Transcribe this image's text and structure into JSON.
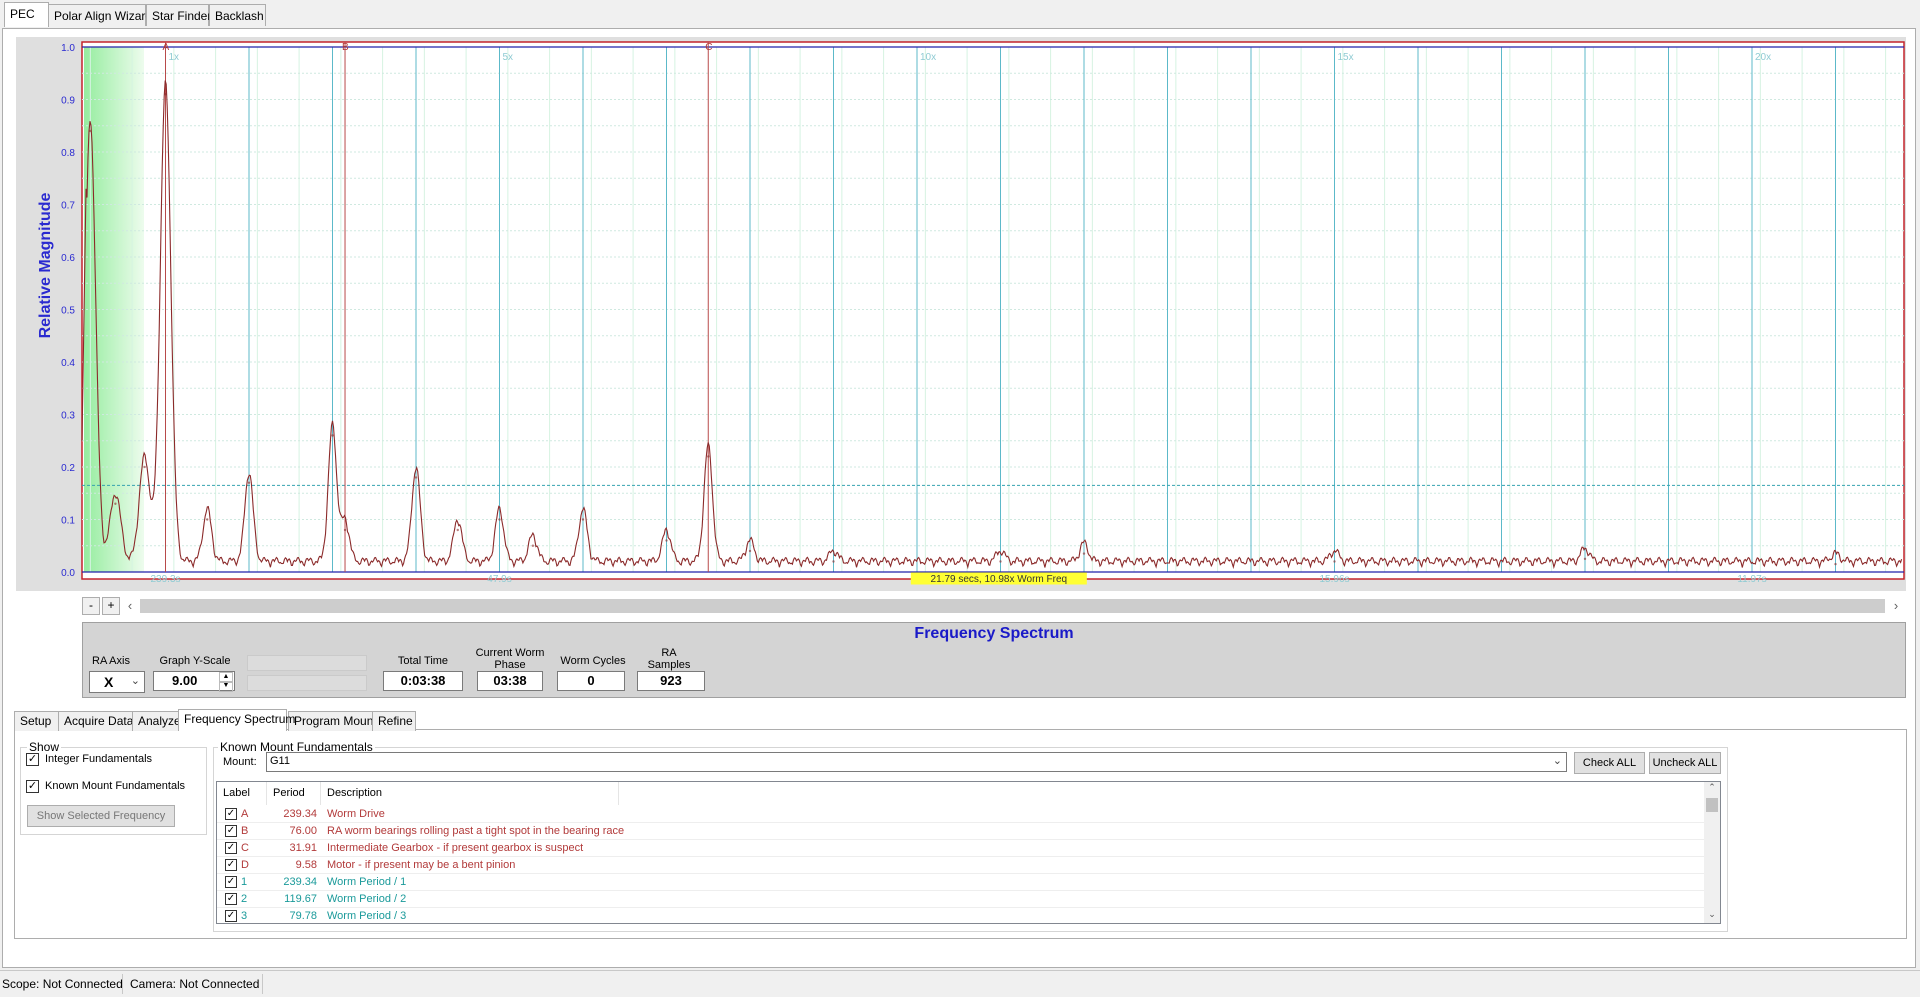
{
  "top_tabs": [
    "PEC",
    "Polar Align Wizard",
    "Star Finder",
    "Backlash"
  ],
  "chart_data": {
    "type": "line",
    "title": "",
    "ylabel": "Relative Magnitude",
    "xlabel": "",
    "ylim": [
      0,
      1.0
    ],
    "y_ticks": [
      "0.0",
      "0.1",
      "0.2",
      "0.3",
      "0.4",
      "0.5",
      "0.6",
      "0.7",
      "0.8",
      "0.9",
      "1.0"
    ],
    "harmonic_labels": [
      "1x",
      "5x",
      "10x",
      "15x",
      "20x"
    ],
    "bottom_period_labels": [
      "239.3s",
      "47.9s",
      "21.79 secs, 10.98x Worm Freq",
      "15.96s",
      "11.97s"
    ],
    "fundamental_markers": [
      "A",
      "B",
      "C"
    ],
    "threshold": 0.165,
    "series": [
      {
        "color": "#8b2a2a",
        "peaks": [
          {
            "x": 0.1,
            "y": 0.84
          },
          {
            "x": 0.4,
            "y": 0.13
          },
          {
            "x": 0.75,
            "y": 0.2
          },
          {
            "x": 1.0,
            "y": 0.91
          },
          {
            "x": 1.5,
            "y": 0.1
          },
          {
            "x": 2.0,
            "y": 0.17
          },
          {
            "x": 3.0,
            "y": 0.26
          },
          {
            "x": 3.15,
            "y": 0.08
          },
          {
            "x": 4.0,
            "y": 0.18
          },
          {
            "x": 4.5,
            "y": 0.08
          },
          {
            "x": 5.0,
            "y": 0.1
          },
          {
            "x": 5.4,
            "y": 0.05
          },
          {
            "x": 6.0,
            "y": 0.1
          },
          {
            "x": 7.0,
            "y": 0.06
          },
          {
            "x": 7.5,
            "y": 0.22
          },
          {
            "x": 8.0,
            "y": 0.04
          },
          {
            "x": 9.0,
            "y": 0.02
          },
          {
            "x": 11.0,
            "y": 0.02
          },
          {
            "x": 12.0,
            "y": 0.035
          },
          {
            "x": 15.0,
            "y": 0.02
          },
          {
            "x": 18.0,
            "y": 0.025
          },
          {
            "x": 21.0,
            "y": 0.015
          }
        ]
      }
    ]
  },
  "info": {
    "title": "Frequency Spectrum",
    "ra_axis_label": "RA Axis",
    "ra_axis_value": "X",
    "y_scale_label": "Graph Y-Scale",
    "y_scale_value": "9.00",
    "total_time_label": "Total Time",
    "total_time_value": "0:03:38",
    "worm_phase_label_1": "Current Worm",
    "worm_phase_label_2": "Phase",
    "worm_phase_value": "03:38",
    "worm_cycles_label": "Worm Cycles",
    "worm_cycles_value": "0",
    "ra_samples_label_1": "RA",
    "ra_samples_label_2": "Samples",
    "ra_samples_value": "923"
  },
  "scroll": {
    "minus": "-",
    "plus": "+"
  },
  "bottom_tabs": [
    "Setup",
    "Acquire Data",
    "Analyze",
    "Frequency Spectrum",
    "Program Mount",
    "Refine"
  ],
  "show": {
    "title": "Show",
    "integer_fundamentals": "Integer Fundamentals",
    "known_mount_fundamentals": "Known Mount Fundamentals",
    "show_selected_button": "Show Selected Frequency"
  },
  "kmf": {
    "title": "Known Mount Fundamentals",
    "mount_label": "Mount:",
    "mount_value": "G11",
    "check_all": "Check ALL",
    "uncheck_all": "Uncheck ALL",
    "columns": [
      "Label",
      "Period",
      "Description"
    ],
    "rows": [
      {
        "label": "A",
        "period": "239.34",
        "desc": "Worm Drive",
        "color": "#b23a3a"
      },
      {
        "label": "B",
        "period": "76.00",
        "desc": "RA worm bearings rolling past a tight spot in the bearing race",
        "color": "#b23a3a"
      },
      {
        "label": "C",
        "period": "31.91",
        "desc": "Intermediate Gearbox - if present gearbox is suspect",
        "color": "#b23a3a"
      },
      {
        "label": "D",
        "period": "9.58",
        "desc": "Motor - if present may be a bent pinion",
        "color": "#b23a3a"
      },
      {
        "label": "1",
        "period": "239.34",
        "desc": "Worm Period / 1",
        "color": "#1a9a9a"
      },
      {
        "label": "2",
        "period": "119.67",
        "desc": "Worm Period / 2",
        "color": "#1a9a9a"
      },
      {
        "label": "3",
        "period": "79.78",
        "desc": "Worm Period / 3",
        "color": "#1a9a9a"
      }
    ]
  },
  "status": {
    "scope": "Scope: Not Connected",
    "camera": "Camera: Not Connected"
  }
}
